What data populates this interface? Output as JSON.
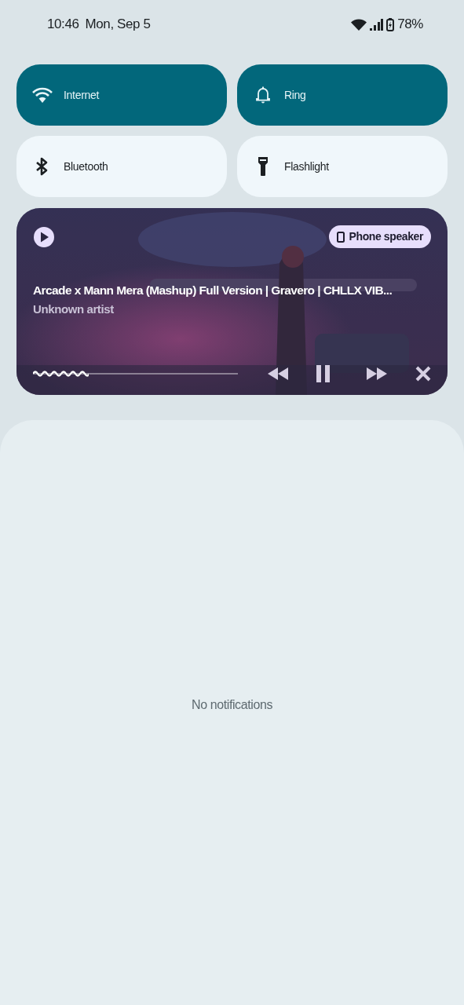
{
  "status_bar": {
    "time": "10:46",
    "date": "Mon, Sep 5",
    "battery": "78%"
  },
  "tiles": [
    {
      "kind": "wifi",
      "label": "Internet",
      "on": true
    },
    {
      "kind": "bell",
      "label": "Ring",
      "on": true
    },
    {
      "kind": "bluetooth",
      "label": "Bluetooth",
      "on": false
    },
    {
      "kind": "flashlight",
      "label": "Flashlight",
      "on": false
    }
  ],
  "media": {
    "title": "Arcade x Mann Mera (Mashup) Full Version | Gravero | CHLLX VIB...",
    "artist": "Unknown artist",
    "output": "Phone speaker",
    "playing": true,
    "level": 0.27
  },
  "notifications": {
    "empty_text": "No notifications"
  }
}
